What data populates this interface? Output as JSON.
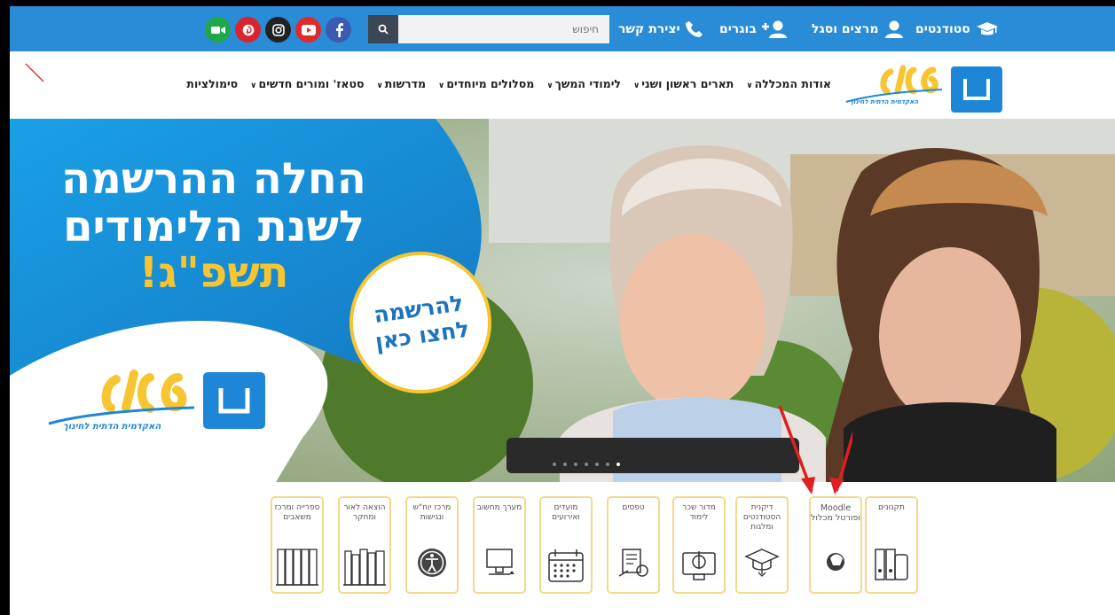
{
  "topbar": {
    "students": "סטודנטים",
    "faculty": "מרצים וסגל",
    "alumni": "בוגרים",
    "contact": "יצירת קשר",
    "search_placeholder": "חיפוש"
  },
  "social": [
    "facebook-icon",
    "youtube-icon",
    "instagram-icon",
    "pinterest-icon",
    "video-icon"
  ],
  "colors": {
    "topbar": "#2a8bd6",
    "accent_yellow": "#f6c531",
    "nav_text": "#222222",
    "hero_blue": "#1a86d9"
  },
  "nav": {
    "items": [
      "אודות המכללה",
      "תארים ראשון ושני",
      "לימודי המשך",
      "מסלולים מיוחדים",
      "מדרשות",
      "סטאז' ומורים חדשים",
      "סימולציות"
    ]
  },
  "logo": {
    "name": "שאנן",
    "tagline": "האקדמית הדתית לחינוך"
  },
  "hero": {
    "line1": "החלה ההרשמה",
    "line2": "לשנת הלימודים",
    "line3": "תשפ\"ג!",
    "cta_line1": "להרשמה",
    "cta_line2": "לחצו כאן"
  },
  "tiles": [
    {
      "label": "תקנונים",
      "icon": "binders-icon"
    },
    {
      "label": "Moodle ופורטל מכלול",
      "icon": "moodle-icon"
    },
    {
      "label": "דיקנית הסטודנטים ומלגות",
      "icon": "graduation-icon"
    },
    {
      "label": "מדור שכר לימוד",
      "icon": "payment-icon"
    },
    {
      "label": "טפסים",
      "icon": "forms-icon"
    },
    {
      "label": "מועדים ואירועים",
      "icon": "calendar-icon"
    },
    {
      "label": "מערך מחשוב",
      "icon": "computer-icon"
    },
    {
      "label": "מרכז יוח\"ש ונגישות",
      "icon": "accessibility-icon"
    },
    {
      "label": "הוצאה לאור ומחקר",
      "icon": "books-icon"
    },
    {
      "label": "ספרייה ומרכז משאבים",
      "icon": "library-icon"
    }
  ]
}
